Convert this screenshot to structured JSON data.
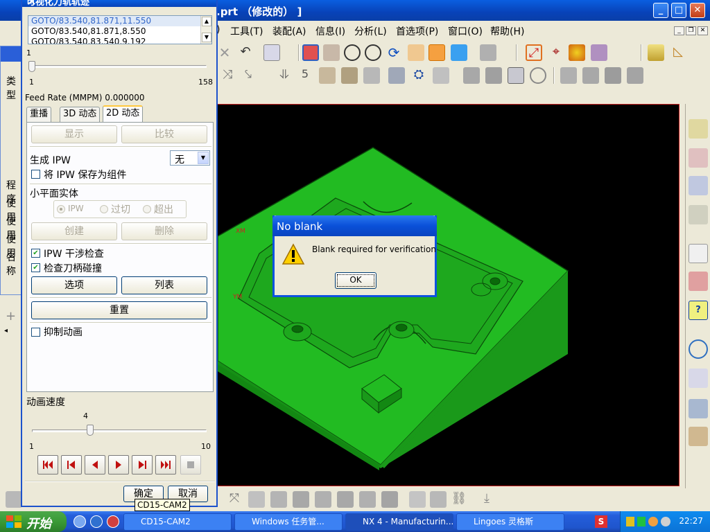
{
  "main_window": {
    "title": ".prt （修改的）  ]",
    "buttons": {
      "minimize": "_",
      "maximize": "□",
      "close": "✕"
    }
  },
  "menu": [
    "工具(T)",
    "装配(A)",
    "信息(I)",
    "分析(L)",
    "首选项(P)",
    "窗口(O)",
    "帮助(H)"
  ],
  "menu_partial": ")",
  "back_dialog_labels": [
    "类型",
    "程序",
    "使用",
    "使用",
    "使用",
    "名称"
  ],
  "vis_dialog": {
    "title": "可视化刀轨轨迹",
    "goto_rows": [
      "GOTO/83.540,81.871,11.550",
      "GOTO/83.540,81.871,8.550",
      "GOTO/83.540,83.540,9.192"
    ],
    "step_slider": {
      "label": "1",
      "min": "1",
      "max": "158",
      "value": 1
    },
    "feed_rate": "Feed Rate (MMPM) 0.000000",
    "tabs": [
      "重播",
      "3D 动态",
      "2D 动态"
    ],
    "active_tab": "2D 动态",
    "display_button": "显示",
    "compare_button": "比较",
    "generate_ipw_label": "生成 IPW",
    "generate_ipw_value": "无",
    "save_ipw_label": "将 IPW 保存为组件",
    "facet_solid_label": "小平面实体",
    "facet_options": [
      "IPW",
      "过切",
      "超出"
    ],
    "create_button": "创建",
    "delete_button": "删除",
    "ipw_interference_label": "IPW 干涉检查",
    "holder_collision_label": "检查刀柄碰撞",
    "options_button": "选项",
    "list_button": "列表",
    "reset_button": "重置",
    "suppress_anim_label": "抑制动画",
    "anim_speed_label": "动画速度",
    "anim_speed": {
      "value_label": "4",
      "min": "1",
      "max": "10",
      "value": 4
    },
    "ok_button": "确定",
    "cancel_button": "取消"
  },
  "tooltip": "CD15-CAM2",
  "no_blank": {
    "title": "No blank",
    "message": "Blank required for verification",
    "ok": "OK"
  },
  "viewport_labels": {
    "xm": "XM",
    "ym": "YM"
  },
  "taskbar": {
    "start": "开始",
    "tasks": [
      "CD15-CAM2",
      "Windows 任务管...",
      "NX 4 - Manufacturin...",
      "Lingoes 灵格斯"
    ],
    "clock": "22:27"
  },
  "colors": {
    "part": "#22bb22",
    "viewport_bg": "#000000",
    "title_blue": "#0a50d8"
  }
}
